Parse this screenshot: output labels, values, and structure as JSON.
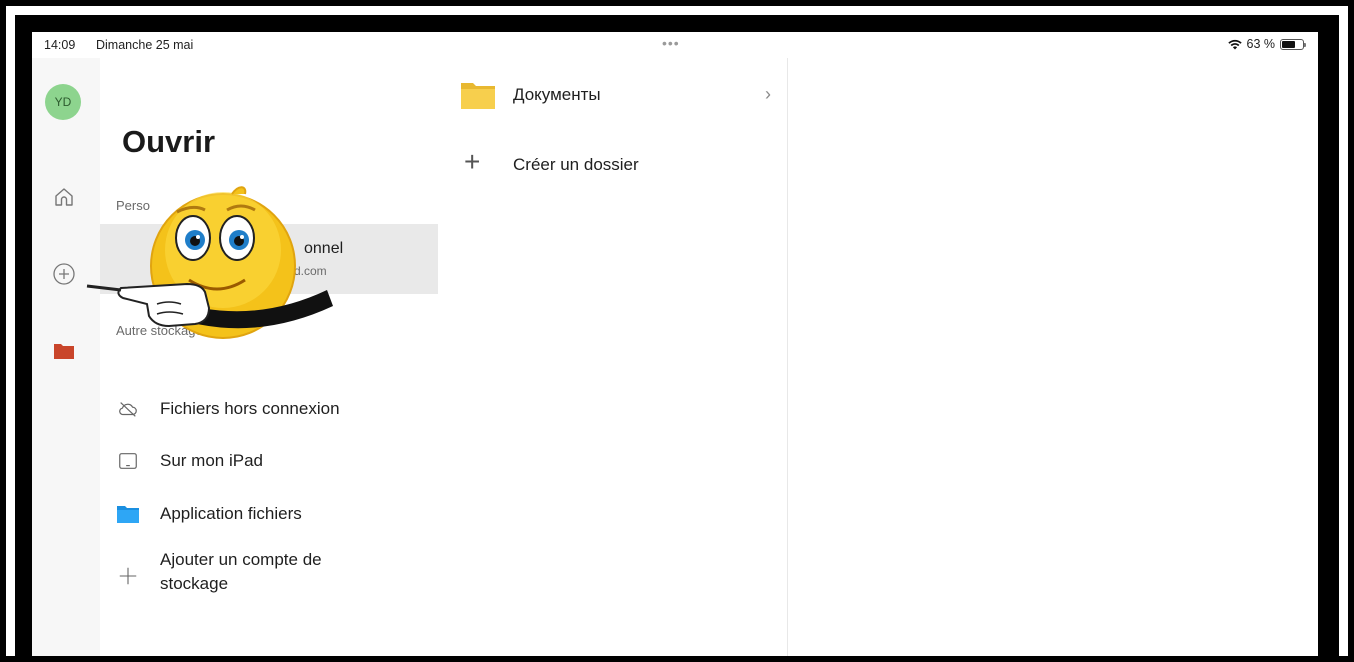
{
  "status_bar": {
    "time": "14:09",
    "date": "Dimanche 25 mai",
    "dots": "•••",
    "battery_percent": "63 %",
    "battery_level": 0.63
  },
  "rail": {
    "avatar_initials": "YD",
    "items": [
      "home-icon",
      "plus-circle-icon",
      "folder-icon"
    ],
    "active_color": "#c9452a"
  },
  "open_panel": {
    "title": "Ouvrir",
    "personal_section_label": "Perso",
    "account_name": "onnel",
    "account_email": "d.com",
    "other_storage_label": "Autre stockage",
    "items": [
      {
        "icon": "cloud-off-icon",
        "label": "Fichiers hors connexion"
      },
      {
        "icon": "ipad-icon",
        "label": "Sur mon iPad"
      },
      {
        "icon": "blue-folder-icon",
        "label": "Application fichiers"
      },
      {
        "icon": "plus-icon",
        "label": "Ajouter un compte de stockage"
      }
    ]
  },
  "documents_panel": {
    "folder_label": "Документы",
    "create_label": "Créer un dossier",
    "folder_color": "#f5c842"
  }
}
